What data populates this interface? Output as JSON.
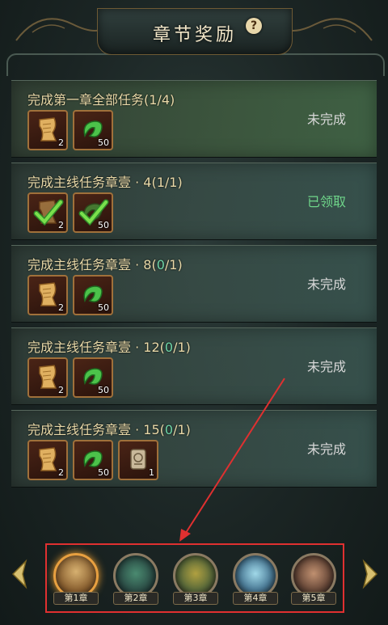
{
  "header": {
    "title": "章节奖励",
    "help": "?"
  },
  "tasks": [
    {
      "title": "完成第一章全部任务",
      "progress": "(1/4)",
      "status": "未完成",
      "rewards": [
        {
          "icon": "scroll-icon",
          "qty": "2"
        },
        {
          "icon": "jade-swirl-icon",
          "qty": "50"
        }
      ]
    },
    {
      "title": "完成主线任务章壹 · 4",
      "progress": "(1/1)",
      "status": "已领取",
      "rewards": [
        {
          "icon": "scroll-icon",
          "qty": "2"
        },
        {
          "icon": "jade-swirl-icon",
          "qty": "50"
        }
      ]
    },
    {
      "title": "完成主线任务章壹 · 8",
      "progress_open": "(",
      "progress_done": "0",
      "progress_close": "/1)",
      "status": "未完成",
      "rewards": [
        {
          "icon": "scroll-icon",
          "qty": "2"
        },
        {
          "icon": "jade-swirl-icon",
          "qty": "50"
        }
      ]
    },
    {
      "title": "完成主线任务章壹 · 12",
      "progress_open": "(",
      "progress_done": "0",
      "progress_close": "/1)",
      "status": "未完成",
      "rewards": [
        {
          "icon": "scroll-icon",
          "qty": "2"
        },
        {
          "icon": "jade-swirl-icon",
          "qty": "50"
        }
      ]
    },
    {
      "title": "完成主线任务章壹 · 15",
      "progress_open": "(",
      "progress_done": "0",
      "progress_close": "/1)",
      "status": "未完成",
      "rewards": [
        {
          "icon": "scroll-icon",
          "qty": "2"
        },
        {
          "icon": "jade-swirl-icon",
          "qty": "50"
        },
        {
          "icon": "map-scroll-icon",
          "qty": "1"
        }
      ]
    }
  ],
  "chapters": [
    {
      "label": "第1章",
      "active": true
    },
    {
      "label": "第2章",
      "active": false
    },
    {
      "label": "第3章",
      "active": false
    },
    {
      "label": "第4章",
      "active": false
    },
    {
      "label": "第5章",
      "active": false
    }
  ],
  "colors": {
    "title_text": "#e9d9a8",
    "progress_highlight": "#6fd6a8",
    "claimed_status": "#6fd68a",
    "annotation_red": "#e03030"
  }
}
